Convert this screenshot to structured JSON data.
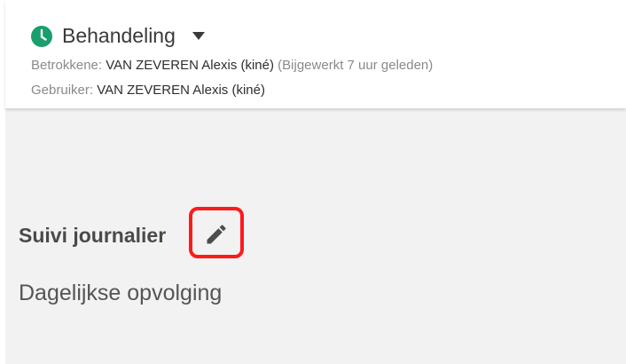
{
  "header": {
    "status_icon": "clock-icon",
    "status_color": "#1a9e6e",
    "title": "Behandeling",
    "dropdown_icon": "caret-down-icon",
    "involved_label": "Betrokkene:",
    "involved_value": "VAN ZEVEREN Alexis (kiné)",
    "updated_note": "(Bijgewerkt 7 uur geleden)",
    "user_label": "Gebruiker:",
    "user_value": "VAN ZEVEREN Alexis (kiné)"
  },
  "section": {
    "title": "Suivi journalier",
    "edit_icon": "pencil-icon",
    "highlight_color": "#ff1a1a",
    "subtitle": "Dagelijkse opvolging"
  }
}
